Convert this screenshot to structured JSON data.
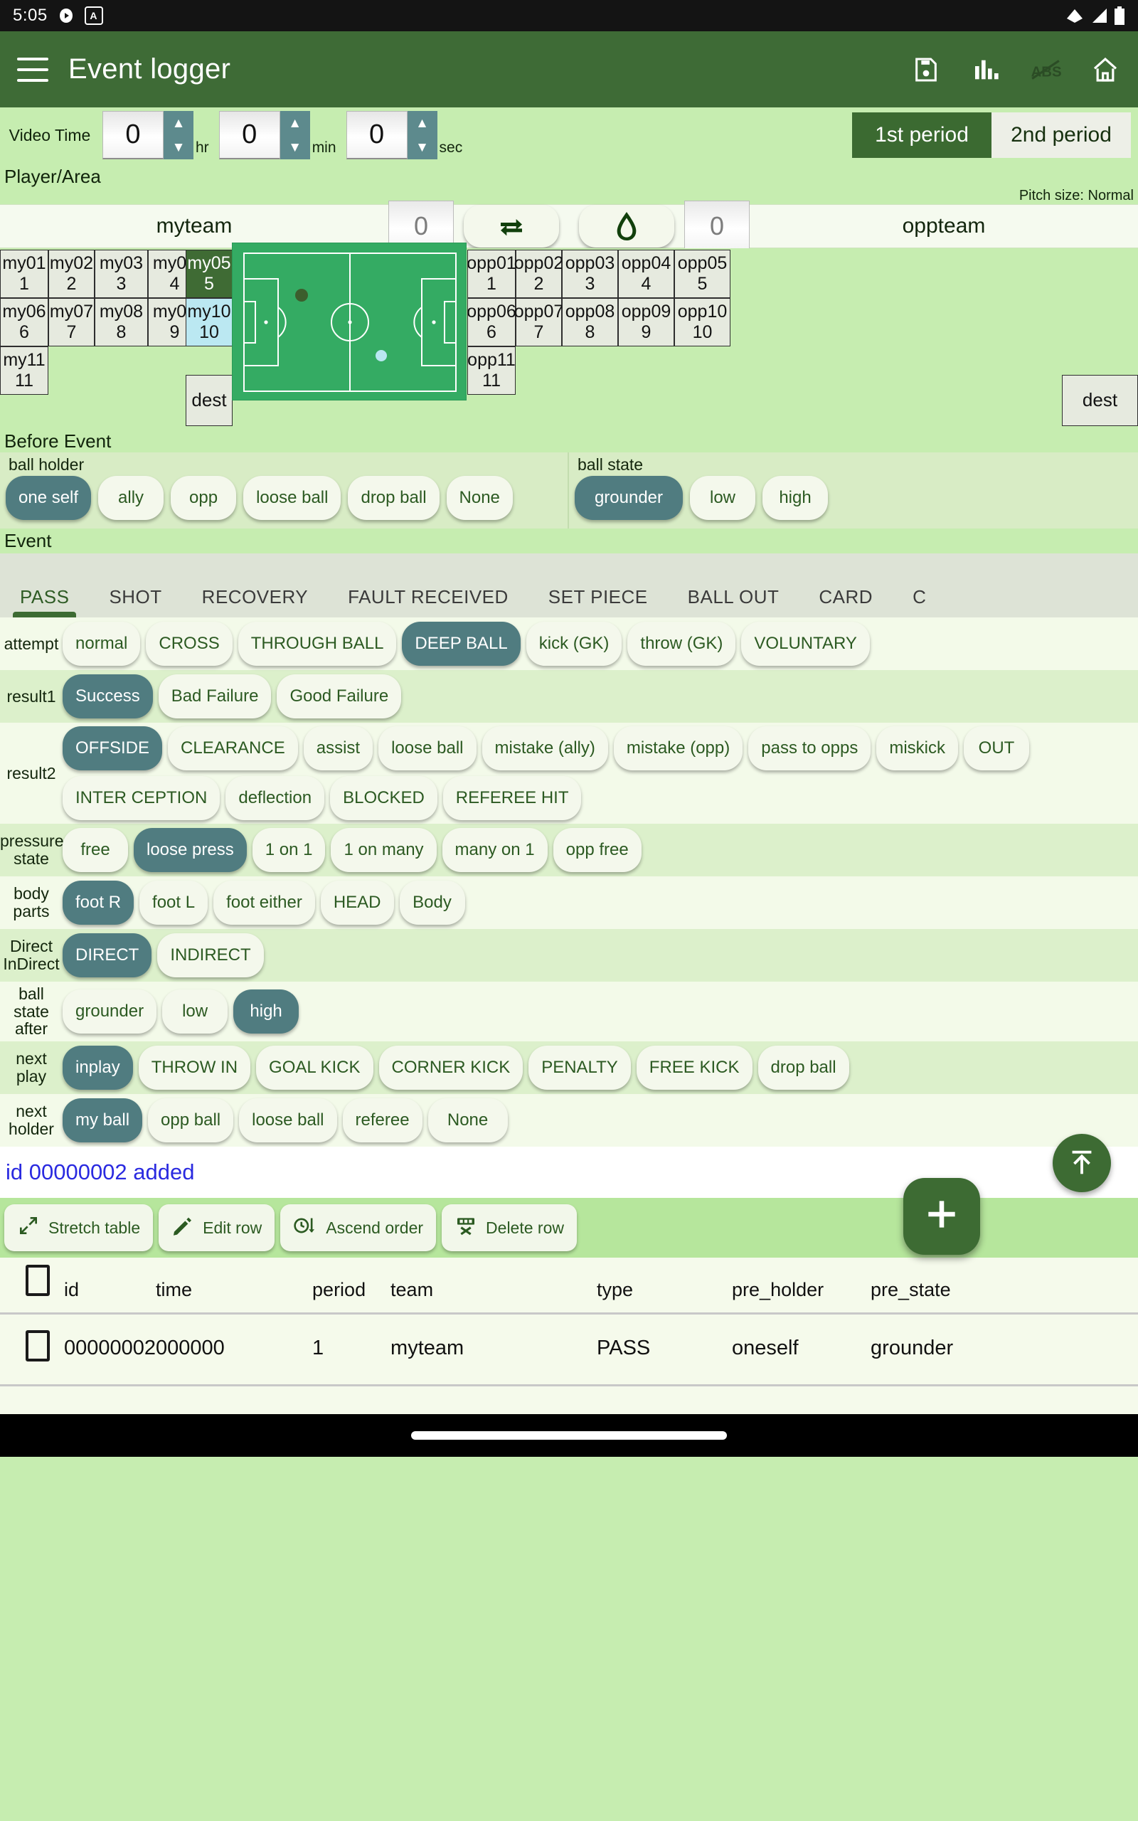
{
  "status_bar": {
    "time": "5:05",
    "icons_left": [
      "play-circle-icon",
      "alarm-chip-icon"
    ],
    "icons_right": [
      "wifi-icon",
      "signal-icon",
      "battery-icon"
    ]
  },
  "app_bar": {
    "title": "Event logger",
    "menu_icon": "hamburger-menu-icon",
    "actions": [
      "save-icon",
      "chart-icon",
      "abs-off-icon",
      "home-icon"
    ]
  },
  "video_time": {
    "label": "Video Time",
    "hr": {
      "value": "0",
      "unit": "hr"
    },
    "min": {
      "value": "0",
      "unit": "min"
    },
    "sec": {
      "value": "0",
      "unit": "sec"
    },
    "periods": [
      {
        "label": "1st period",
        "active": true
      },
      {
        "label": "2nd period",
        "active": false
      }
    ]
  },
  "player_area": {
    "section_title": "Player/Area",
    "pitch_size": "Pitch size: Normal",
    "my_team_name": "myteam",
    "my_score": "0",
    "opp_team_name": "oppteam",
    "opp_score": "0",
    "swap_icon": "swap-arrows-icon",
    "erase_icon": "eraser-icon",
    "my_players": [
      {
        "name": "my01",
        "num": "1",
        "state": "normal"
      },
      {
        "name": "my02",
        "num": "2",
        "state": "normal"
      },
      {
        "name": "my03",
        "num": "3",
        "state": "normal"
      },
      {
        "name": "my04",
        "num": "4",
        "state": "normal"
      },
      {
        "name": "my05",
        "num": "5",
        "state": "selected"
      },
      {
        "name": "my06",
        "num": "6",
        "state": "normal"
      },
      {
        "name": "my07",
        "num": "7",
        "state": "normal"
      },
      {
        "name": "my08",
        "num": "8",
        "state": "normal"
      },
      {
        "name": "my09",
        "num": "9",
        "state": "normal"
      },
      {
        "name": "my10",
        "num": "10",
        "state": "dest"
      },
      {
        "name": "my11",
        "num": "11",
        "state": "normal"
      }
    ],
    "opp_players": [
      {
        "name": "opp01",
        "num": "1",
        "state": "normal"
      },
      {
        "name": "opp02",
        "num": "2",
        "state": "normal"
      },
      {
        "name": "opp03",
        "num": "3",
        "state": "normal"
      },
      {
        "name": "opp04",
        "num": "4",
        "state": "normal"
      },
      {
        "name": "opp05",
        "num": "5",
        "state": "normal"
      },
      {
        "name": "opp06",
        "num": "6",
        "state": "normal"
      },
      {
        "name": "opp07",
        "num": "7",
        "state": "normal"
      },
      {
        "name": "opp08",
        "num": "8",
        "state": "normal"
      },
      {
        "name": "opp09",
        "num": "9",
        "state": "normal"
      },
      {
        "name": "opp10",
        "num": "10",
        "state": "normal"
      },
      {
        "name": "opp11",
        "num": "11",
        "state": "normal"
      }
    ],
    "my_dest_label": "dest",
    "opp_dest_label": "dest"
  },
  "before_event": {
    "title": "Before Event",
    "ball_holder": {
      "label": "ball holder",
      "options": [
        "one self",
        "ally",
        "opp",
        "loose ball",
        "drop ball",
        "None"
      ],
      "selected": "one self"
    },
    "ball_state": {
      "label": "ball state",
      "options": [
        "grounder",
        "low",
        "high"
      ],
      "selected": "grounder"
    }
  },
  "event": {
    "title": "Event",
    "tabs": [
      {
        "label": "PASS",
        "active": true
      },
      {
        "label": "SHOT",
        "active": false
      },
      {
        "label": "RECOVERY",
        "active": false
      },
      {
        "label": "FAULT RECEIVED",
        "active": false
      },
      {
        "label": "SET PIECE",
        "active": false
      },
      {
        "label": "BALL OUT",
        "active": false
      },
      {
        "label": "CARD",
        "active": false
      },
      {
        "label": "C",
        "active": false
      }
    ],
    "rows": [
      {
        "label": "attempt",
        "options": [
          "normal",
          "CROSS",
          "THROUGH BALL",
          "DEEP BALL",
          "kick (GK)",
          "throw (GK)",
          "VOLUNTARY"
        ],
        "selected": [
          "DEEP BALL"
        ]
      },
      {
        "label": "result1",
        "options": [
          "Success",
          "Bad Failure",
          "Good Failure"
        ],
        "selected": [
          "Success"
        ]
      },
      {
        "label": "result2",
        "options": [
          "OFFSIDE",
          "CLEARANCE",
          "assist",
          "loose ball",
          "mistake (ally)",
          "mistake (opp)",
          "pass to opps",
          "miskick",
          "OUT",
          "INTER CEPTION",
          "deflection",
          "BLOCKED",
          "REFEREE HIT"
        ],
        "selected": [
          "OFFSIDE"
        ]
      },
      {
        "label": "pressure state",
        "options": [
          "free",
          "loose press",
          "1 on 1",
          "1 on many",
          "many on 1",
          "opp free"
        ],
        "selected": [
          "loose press"
        ]
      },
      {
        "label": "body parts",
        "options": [
          "foot R",
          "foot L",
          "foot either",
          "HEAD",
          "Body"
        ],
        "selected": [
          "foot R"
        ]
      },
      {
        "label": "Direct InDirect",
        "options": [
          "DIRECT",
          "INDIRECT"
        ],
        "selected": [
          "DIRECT"
        ]
      },
      {
        "label": "ball state after",
        "options": [
          "grounder",
          "low",
          "high"
        ],
        "selected": [
          "high"
        ]
      },
      {
        "label": "next play",
        "options": [
          "inplay",
          "THROW IN",
          "GOAL KICK",
          "CORNER KICK",
          "PENALTY",
          "FREE KICK",
          "drop ball"
        ],
        "selected": [
          "inplay"
        ]
      },
      {
        "label": "next holder",
        "options": [
          "my ball",
          "opp ball",
          "loose ball",
          "referee",
          "None"
        ],
        "selected": [
          "my ball"
        ]
      }
    ]
  },
  "status_message": "id 00000002 added",
  "toolbar": {
    "buttons": [
      {
        "label": "Stretch table",
        "icon": "stretch-icon"
      },
      {
        "label": "Edit row",
        "icon": "pencil-icon"
      },
      {
        "label": "Ascend order",
        "icon": "clock-sort-icon"
      },
      {
        "label": "Delete row",
        "icon": "delete-row-icon"
      }
    ],
    "fab_add": "add-icon",
    "fab_up": "scroll-to-top-icon"
  },
  "table": {
    "columns": [
      "id",
      "time",
      "period",
      "team",
      "type",
      "pre_holder",
      "pre_state"
    ],
    "rows": [
      {
        "checked": false,
        "id": "00000002",
        "time": "000000",
        "period": "1",
        "team": "myteam",
        "type": "PASS",
        "pre_holder": "oneself",
        "pre_state": "grounder"
      }
    ]
  },
  "colors": {
    "app_bar": "#3e6b36",
    "page_bg": "#c6edb0",
    "chip_on": "#507c80",
    "chip_off": "#f4f8ec",
    "selected_player": "#3f6b34",
    "dest_player": "#bbe8f2",
    "pitch": "#34ab63",
    "status_text": "#2a2ae0"
  }
}
